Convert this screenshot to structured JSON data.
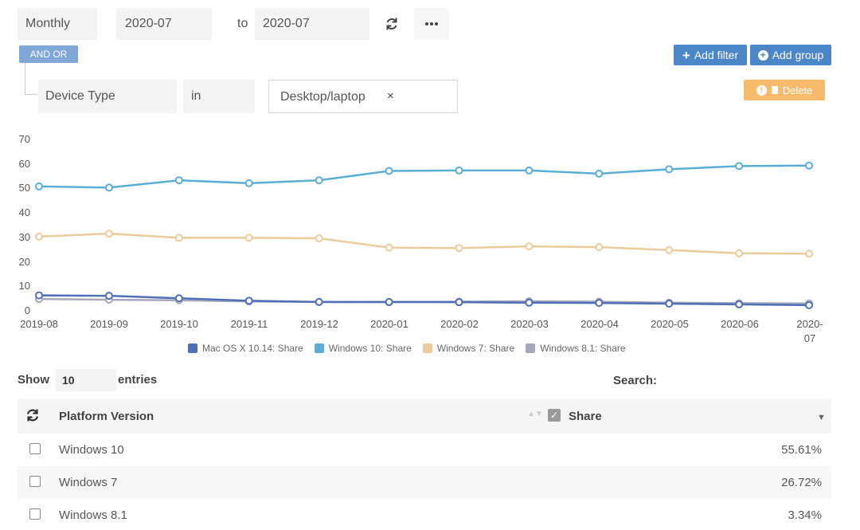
{
  "filter_bar": {
    "period": "Monthly",
    "from_date": "2020-07",
    "to_label": "to",
    "to_date": "2020-07",
    "refresh_icon": "refresh-icon",
    "more_icon": "ellipsis-icon",
    "and_or_label": "AND OR",
    "add_filter_label": "Add filter",
    "add_group_label": "Add group",
    "delete_label": "Delete"
  },
  "filter_row": {
    "field": "Device Type",
    "operator": "in",
    "value": "Desktop/laptop",
    "remove_glyph": "×"
  },
  "chart_data": {
    "type": "line",
    "x": [
      "2019-08",
      "2019-09",
      "2019-10",
      "2019-11",
      "2019-12",
      "2020-01",
      "2020-02",
      "2020-03",
      "2020-04",
      "2020-05",
      "2020-06",
      "2020-07"
    ],
    "x_tick_labels": [
      "2019-08",
      "2019-09",
      "2019-10",
      "2019-11",
      "2019-12",
      "2020-01",
      "2020-02",
      "2020-03",
      "2020-04",
      "2020-05",
      "2020-06",
      "2020-"
    ],
    "x_tick_label_last_line2": "07",
    "ylim": [
      0,
      70
    ],
    "y_ticks": [
      "70",
      "60",
      "50",
      "40",
      "30",
      "20",
      "10",
      "0"
    ],
    "grid": false,
    "legend_position": "bottom",
    "series": [
      {
        "name": "Mac OS X 10.14: Share",
        "color": "#4f6fb7",
        "values": [
          6.0,
          5.8,
          4.8,
          3.8,
          3.3,
          3.3,
          3.2,
          3.0,
          2.9,
          2.6,
          2.3,
          2.0
        ]
      },
      {
        "name": "Windows 10: Share",
        "color": "#5aaed4",
        "values": [
          50.5,
          50.0,
          53.0,
          51.8,
          53.0,
          56.8,
          57.0,
          57.0,
          55.7,
          57.5,
          58.8,
          59.0
        ]
      },
      {
        "name": "Windows 7: Share",
        "color": "#eccb9b",
        "values": [
          30.0,
          31.2,
          29.5,
          29.5,
          29.3,
          25.5,
          25.3,
          26.0,
          25.7,
          24.5,
          23.2,
          23.0
        ]
      },
      {
        "name": "Windows 8.1: Share",
        "color": "#a7a7bb",
        "values": [
          4.5,
          4.2,
          4.0,
          3.5,
          3.3,
          3.2,
          3.4,
          3.6,
          3.4,
          3.0,
          2.8,
          2.7
        ]
      }
    ]
  },
  "table": {
    "show_label": "Show",
    "page_size": "10",
    "entries_label": "entries",
    "search_label": "Search:",
    "columns": [
      "Platform Version",
      "Share"
    ],
    "rows": [
      {
        "name": "Windows 10",
        "share": "55.61%"
      },
      {
        "name": "Windows 7",
        "share": "26.72%"
      },
      {
        "name": "Windows 8.1",
        "share": "3.34%"
      }
    ]
  }
}
